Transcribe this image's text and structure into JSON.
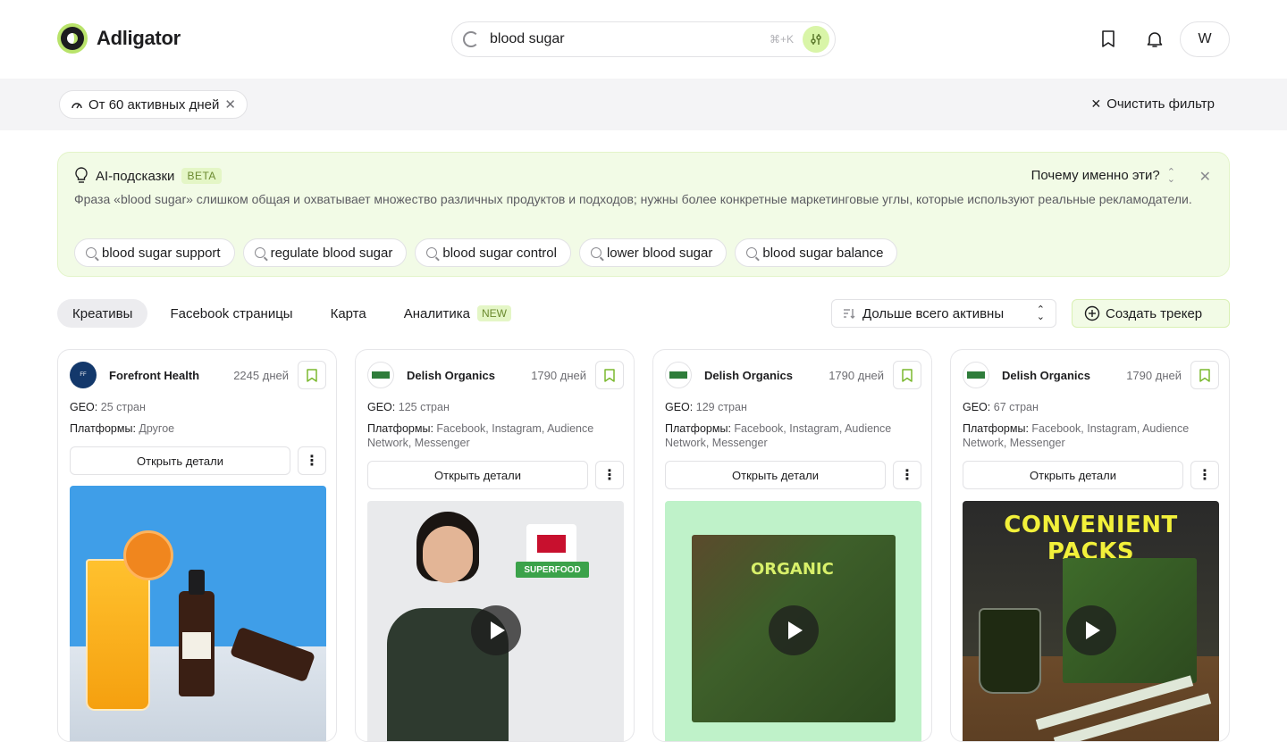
{
  "header": {
    "logo_text": "Adligator",
    "search_value": "blood sugar",
    "search_shortcut": "⌘+K",
    "avatar_initial": "W"
  },
  "filter": {
    "chip_label": "От 60 активных дней",
    "clear_label": "Очистить фильтр"
  },
  "ai": {
    "title": "AI-подсказки",
    "badge": "BETA",
    "why_label": "Почему именно эти?",
    "text": "Фраза «blood sugar» слишком общая и охватывает множество различных продуктов и подходов; нужны более конкретные маркетинговые углы, которые используют реальные рекламодатели.",
    "suggestions": [
      "blood sugar support",
      "regulate blood sugar",
      "blood sugar control",
      "lower blood sugar",
      "blood sugar balance"
    ]
  },
  "tabs": [
    {
      "label": "Креативы",
      "active": true
    },
    {
      "label": "Facebook страницы",
      "active": false
    },
    {
      "label": "Карта",
      "active": false
    },
    {
      "label": "Аналитика",
      "active": false,
      "badge": "NEW"
    }
  ],
  "toolbar": {
    "sort_label": "Дольше всего активны",
    "create_label": "Создать трекер"
  },
  "cards": [
    {
      "brand": "Forefront Health",
      "days": "2245 дней",
      "geo_label": "GEO:",
      "geo": "25 стран",
      "platforms_label": "Платформы:",
      "platforms": "Другое",
      "details": "Открыть детали",
      "video": false
    },
    {
      "brand": "Delish Organics",
      "days": "1790 дней",
      "geo_label": "GEO:",
      "geo": "125 стран",
      "platforms_label": "Платформы:",
      "platforms": "Facebook, Instagram, Audience Network, Messenger",
      "details": "Открыть детали",
      "video": true,
      "overlay": "SUPERFOOD"
    },
    {
      "brand": "Delish Organics",
      "days": "1790 дней",
      "geo_label": "GEO:",
      "geo": "129 стран",
      "platforms_label": "Платформы:",
      "platforms": "Facebook, Instagram, Audience Network, Messenger",
      "details": "Открыть детали",
      "video": true,
      "overlay": "ORGANIC"
    },
    {
      "brand": "Delish Organics",
      "days": "1790 дней",
      "geo_label": "GEO:",
      "geo": "67 стран",
      "platforms_label": "Платформы:",
      "platforms": "Facebook, Instagram, Audience Network, Messenger",
      "details": "Открыть детали",
      "video": true,
      "overlay": "CONVENIENT PACKS"
    }
  ],
  "colors": {
    "accent": "#b9e36b",
    "ai_panel_bg": "#f2fbe6",
    "filterbar_bg": "#f4f4f6"
  }
}
